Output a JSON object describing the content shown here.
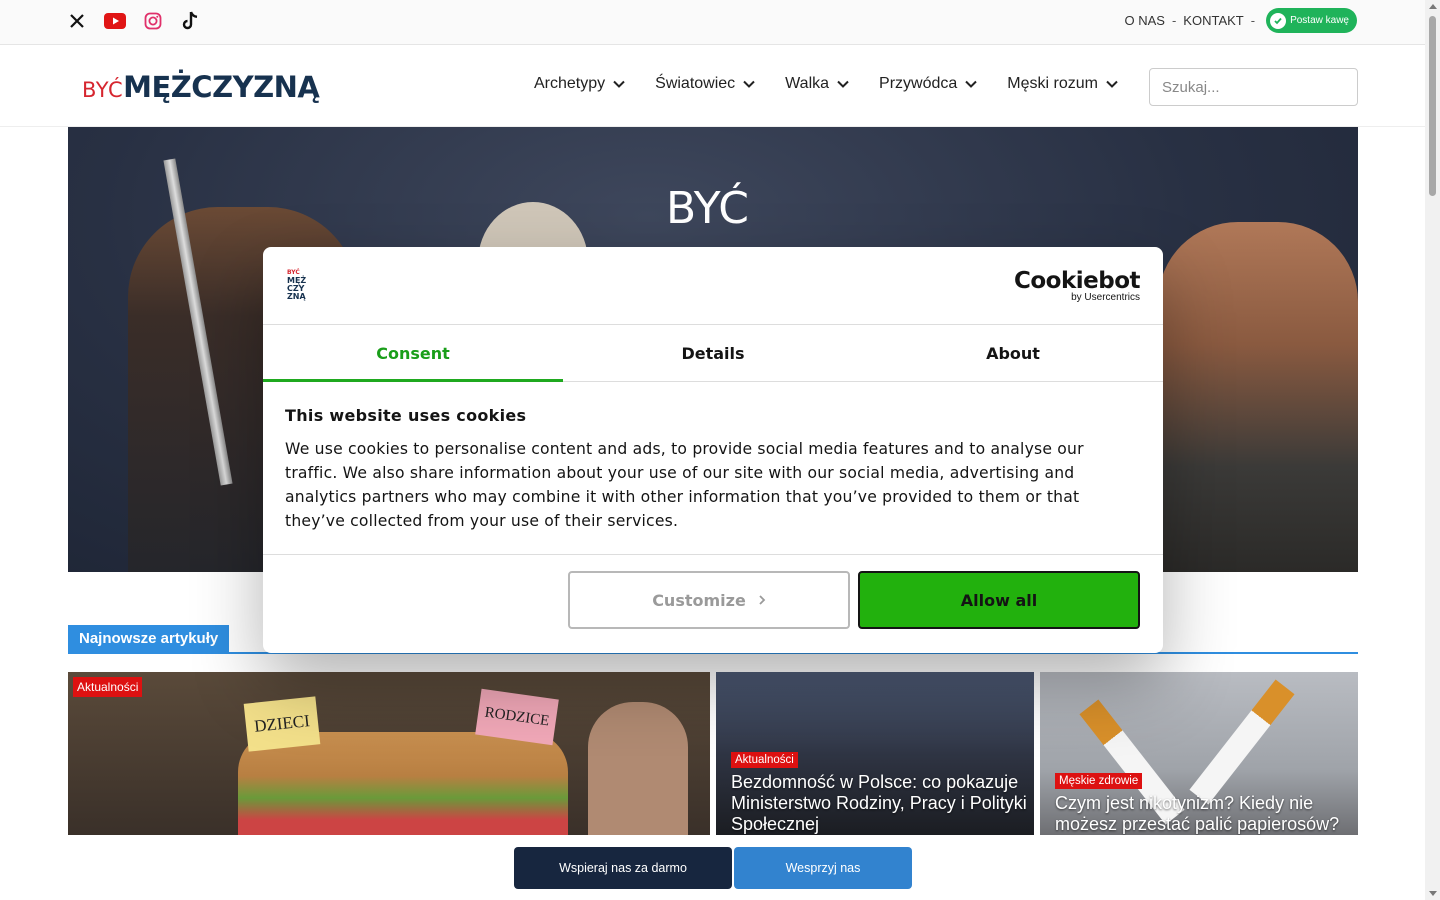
{
  "topbar": {
    "social_icons": [
      "x-icon",
      "youtube-icon",
      "instagram-icon",
      "tiktok-icon"
    ],
    "links": [
      "O NAS",
      "KONTAKT"
    ],
    "separator": "-",
    "coffee_label": "Postaw kawę"
  },
  "header": {
    "logo_part1": "BYĆ",
    "logo_part2": "MĘŻCZYZNĄ",
    "nav": [
      "Archetypy",
      "Światowiec",
      "Walka",
      "Przywódca",
      "Męski rozum"
    ],
    "search_placeholder": "Szukaj..."
  },
  "hero": {
    "title_text": "BYĆ"
  },
  "section": {
    "heading": "Najnowsze artykuły"
  },
  "articles": [
    {
      "badge": "Aktualności",
      "title": "",
      "note1": "DZIECI",
      "note2": "RODZICE"
    },
    {
      "badge": "Aktualności",
      "title": "Bezdomność w Polsce: co pokazuje Ministerstwo Rodziny, Pracy i Polityki Społecznej"
    },
    {
      "badge": "Męskie zdrowie",
      "title": "Czym jest nikotynizm? Kiedy nie możesz przestać palić papierosów?"
    }
  ],
  "cookie_dialog": {
    "logo_lines": [
      "BYĆ",
      "MĘŻ",
      "CZY",
      "ZNĄ"
    ],
    "brand": "Cookiebot",
    "brand_sub": "by Usercentrics",
    "tabs": [
      "Consent",
      "Details",
      "About"
    ],
    "active_tab": "Consent",
    "heading": "This website uses cookies",
    "body": "We use cookies to personalise content and ads, to provide social media features and to analyse our traffic. We also share information about your use of our site with our social media, advertising and analytics partners who may combine it with other information that you’ve provided to them or that they’ve collected from your use of their services.",
    "customize_label": "Customize",
    "allow_label": "Allow all"
  },
  "bottom_buttons": {
    "support_free": "Wspieraj nas za darmo",
    "support": "Wesprzyj nas"
  },
  "colors": {
    "accent_blue": "#2f8ee0",
    "brand_navy": "#17324f",
    "brand_red": "#d6262f",
    "cookie_green": "#22b10d",
    "badge_red": "#d11111"
  }
}
